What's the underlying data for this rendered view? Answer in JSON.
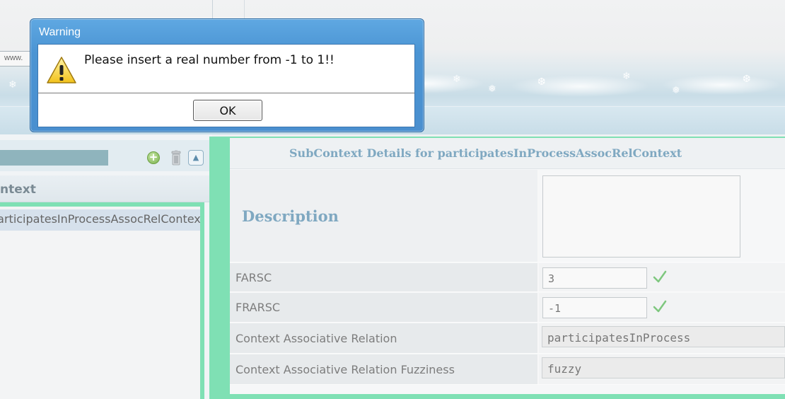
{
  "browser": {
    "url_fragment": "www."
  },
  "left_panel": {
    "header_title": "ntext",
    "selected_item": "participatesInProcessAssocRelContext",
    "icons": [
      "add-icon",
      "delete-icon",
      "collapse-icon"
    ]
  },
  "details": {
    "title": "SubContext Details for participatesInProcessAssocRelContext",
    "description_label": "Description",
    "description_value": "",
    "fields": [
      {
        "label": "FARSC",
        "value": "3",
        "status": "check-icon"
      },
      {
        "label": "FRARSC",
        "value": "-1",
        "status": "check-icon"
      },
      {
        "label": "Context Associative Relation",
        "value": "participatesInProcess"
      },
      {
        "label": "Context Associative Relation Fuzziness",
        "value": "fuzzy"
      }
    ]
  },
  "dialog": {
    "title": "Warning",
    "message": "Please insert a real number from -1 to 1!!",
    "ok_label": "OK",
    "icon": "warning-icon"
  },
  "colors": {
    "accent_green": "#7fe0b4",
    "title_blue": "#7fa8c1",
    "dialog_blue": "#4a8fcf",
    "check_green": "#7ec77e"
  }
}
